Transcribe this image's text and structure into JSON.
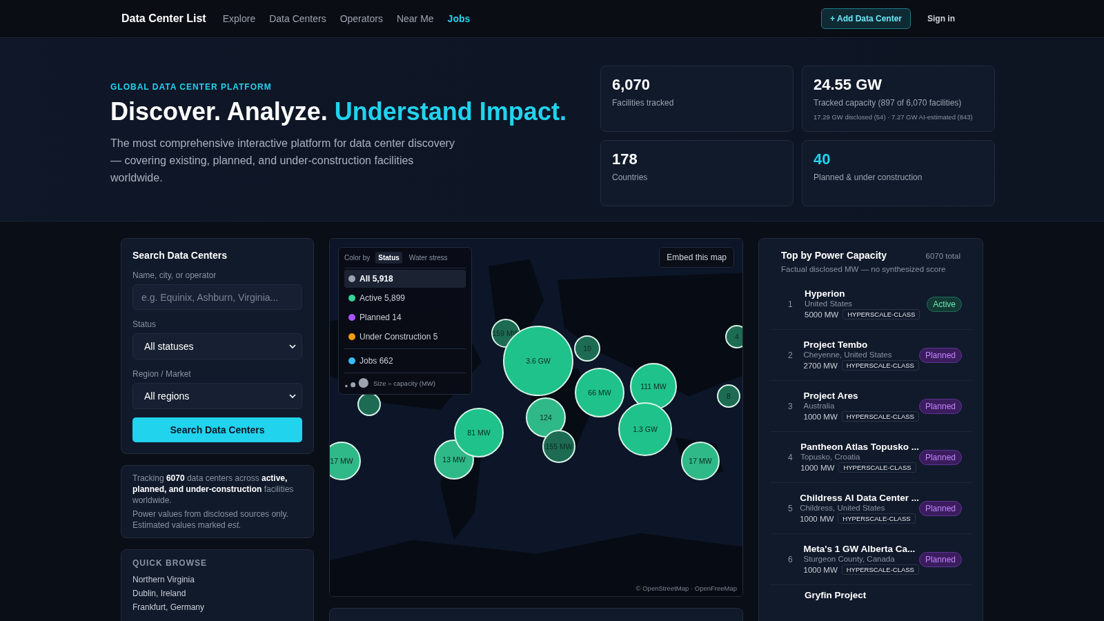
{
  "nav": {
    "brand": "Data Center List",
    "links": [
      {
        "label": "Explore",
        "selected": false
      },
      {
        "label": "Data Centers",
        "selected": false
      },
      {
        "label": "Operators",
        "selected": false
      },
      {
        "label": "Near Me",
        "selected": false
      },
      {
        "label": "Jobs",
        "selected": true
      }
    ],
    "add_button": "+ Add Data Center",
    "sign_in": "Sign in"
  },
  "hero": {
    "eyebrow": "GLOBAL DATA CENTER PLATFORM",
    "title": "Discover. Analyze.",
    "title_accent": "Understand Impact.",
    "description": "The most comprehensive interactive platform for data center discovery — covering existing, planned, and under-construction facilities worldwide.",
    "stats": [
      {
        "value": "6,070",
        "label": "Facilities tracked",
        "accent": false
      },
      {
        "value": "24.55 GW",
        "label": "Tracked capacity (897 of 6,070 facilities)",
        "note": "17.29 GW disclosed (54) · 7.27 GW AI-estimated (843)",
        "accent": false
      },
      {
        "value": "178",
        "label": "Countries",
        "accent": false
      },
      {
        "value": "40",
        "label": "Planned & under construction",
        "accent": true
      }
    ]
  },
  "search": {
    "title": "Search Data Centers",
    "name_label": "Name, city, or operator",
    "placeholder": "e.g. Equinix, Ashburn, Virginia...",
    "status_label": "Status",
    "status_value": "All statuses",
    "region_label": "Region / Market",
    "region_value": "All regions",
    "button": "Search Data Centers"
  },
  "info": {
    "text": "Tracking **6070** data centers across **active, planned, and under-construction** facilities worldwide.",
    "note": "Power values from disclosed sources only. Estimated values marked *est.*"
  },
  "quick_browse": {
    "title": "QUICK BROWSE",
    "items": [
      "Northern Virginia",
      "Dublin, Ireland",
      "Frankfurt, Germany"
    ]
  },
  "map": {
    "color_by_label": "Color by",
    "color_by": [
      {
        "label": "Status",
        "selected": true
      },
      {
        "label": "Water stress",
        "selected": false
      }
    ],
    "legend": [
      {
        "label": "All 5,918",
        "color": "#9ca3af",
        "selected": true
      },
      {
        "label": "Active 5,899",
        "color": "#34d399",
        "selected": false
      },
      {
        "label": "Planned 14",
        "color": "#a855f7",
        "selected": false
      },
      {
        "label": "Under Construction 5",
        "color": "#f59e0b",
        "selected": false
      },
      {
        "label": "Jobs 662",
        "color": "#38bdf8",
        "selected": false
      }
    ],
    "size_note": "Size = capacity (MW)",
    "embed_button": "Embed this map",
    "attribution": "© OpenStreetMap · OpenFreeMap",
    "markers": [
      {
        "color": "#1d6b52"
      },
      {
        "label": "159 MW",
        "color": "#1d6b52"
      },
      {
        "label": "3.6 GW",
        "color": "#1fc28a"
      },
      {
        "label": "10",
        "color": "#1d6b52"
      },
      {
        "label": "66 MW",
        "color": "#1fc28a"
      },
      {
        "label": "111 MW",
        "color": "#1fc28a"
      },
      {
        "label": "1.3 GW",
        "color": "#1fc28a"
      },
      {
        "label": "124",
        "color": "#2fb888"
      },
      {
        "label": "155 MW",
        "color": "#1d6b52"
      },
      {
        "label": "13 MW",
        "color": "#2fb888"
      },
      {
        "label": "81 MW",
        "color": "#1fc28a"
      },
      {
        "label": "17 MW",
        "color": "#2fb888"
      },
      {
        "label": "17 MW",
        "color": "#2fb888"
      },
      {
        "label": "4",
        "color": "#1d6b52"
      },
      {
        "label": "8",
        "color": "#1d6b52"
      }
    ]
  },
  "top": {
    "title": "Top by Power Capacity",
    "total": "6070 total",
    "subtitle": "Factual disclosed MW — no synthesized score",
    "items": [
      {
        "rank": "1",
        "name": "Hyperion",
        "location": "United States",
        "power": "5000 MW",
        "tag": "HYPERSCALE-CLASS",
        "status": "Active",
        "kind": "active"
      },
      {
        "rank": "2",
        "name": "Project Tembo",
        "location": "Cheyenne, United States",
        "power": "2700 MW",
        "tag": "HYPERSCALE-CLASS",
        "status": "Planned",
        "kind": "planned"
      },
      {
        "rank": "3",
        "name": "Project Ares",
        "location": "Australia",
        "power": "1000 MW",
        "tag": "HYPERSCALE-CLASS",
        "status": "Planned",
        "kind": "planned"
      },
      {
        "rank": "4",
        "name": "Pantheon Atlas Topusko ...",
        "location": "Topusko, Croatia",
        "power": "1000 MW",
        "tag": "HYPERSCALE-CLASS",
        "status": "Planned",
        "kind": "planned"
      },
      {
        "rank": "5",
        "name": "Childress AI Data Center ...",
        "location": "Childress, United States",
        "power": "1000 MW",
        "tag": "HYPERSCALE-CLASS",
        "status": "Planned",
        "kind": "planned"
      },
      {
        "rank": "6",
        "name": "Meta's 1 GW Alberta Ca...",
        "location": "Sturgeon County, Canada",
        "power": "1000 MW",
        "tag": "HYPERSCALE-CLASS",
        "status": "Planned",
        "kind": "planned"
      },
      {
        "name": "Gryfin Project"
      }
    ]
  }
}
